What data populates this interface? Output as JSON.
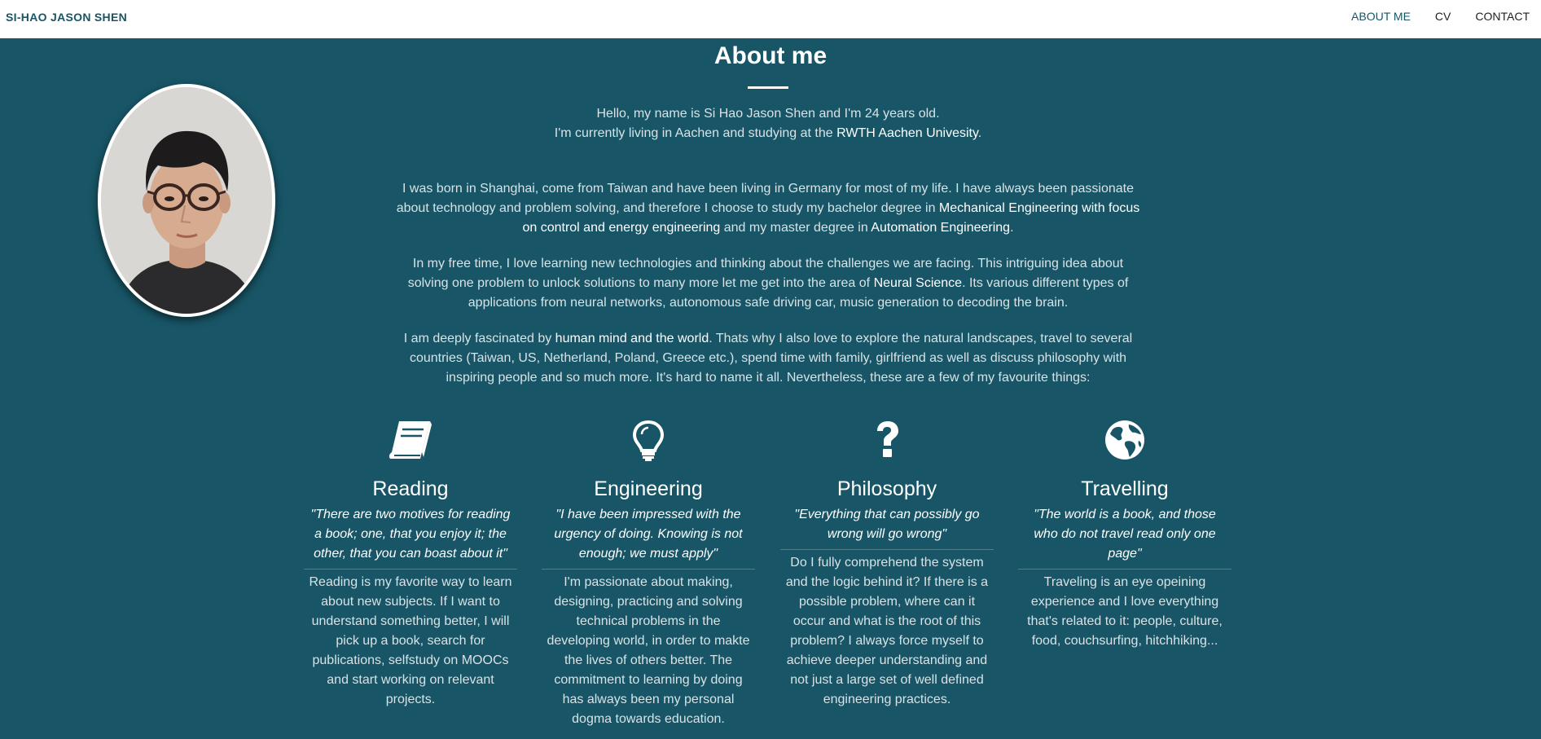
{
  "nav": {
    "brand": "SI-HAO JASON SHEN",
    "links": [
      "ABOUT ME",
      "CV",
      "CONTACT"
    ]
  },
  "about": {
    "title": "About me",
    "p1": [
      {
        "t": "Hello, my name is Si Hao Jason Shen and I'm 24 years old."
      },
      {
        "br": true
      },
      {
        "t": "I'm currently living in Aachen and studying at the "
      },
      {
        "t": "RWTH Aachen Univesity",
        "s": true
      },
      {
        "t": "."
      }
    ],
    "p2": [
      {
        "t": "I was born in Shanghai, come from Taiwan and have been living in Germany for most of my life. I have always been passionate about technology and problem solving, and therefore I choose to study my bachelor degree in "
      },
      {
        "t": "Mechanical Engineering with focus on control and energy engineering",
        "s": true
      },
      {
        "t": " and my master degree in "
      },
      {
        "t": "Automation Engineering",
        "s": true
      },
      {
        "t": "."
      }
    ],
    "p3": [
      {
        "t": "In my free time, I love learning new technologies and thinking about the challenges we are facing. This intriguing idea about solving one problem to unlock solutions to many more let me get into the area of "
      },
      {
        "t": "Neural Science",
        "s": true
      },
      {
        "t": ". Its various different types of applications from neural networks, autonomous safe driving car, music generation to decoding the brain."
      }
    ],
    "p4": [
      {
        "t": "I am deeply fascinated by "
      },
      {
        "t": "human mind and the world",
        "s": true
      },
      {
        "t": ". Thats why I also love to explore the natural landscapes, travel to several countries (Taiwan, US, Netherland, Poland, Greece etc.), spend time with family, girlfriend as well as discuss philosophy with inspiring people and so much more. It's hard to name it all. Nevertheless, these are a few of my favourite things:"
      }
    ]
  },
  "interests": [
    {
      "icon": "book-icon",
      "title": "Reading",
      "quote": "\"There are two motives for reading a book; one, that you enjoy it; the other, that you can boast about it\"",
      "desc": "Reading is my favorite way to learn about new subjects. If I want to understand something better, I will pick up a book, search for publications, selfstudy on MOOCs and start working on relevant projects."
    },
    {
      "icon": "lightbulb-icon",
      "title": "Engineering",
      "quote": "\"I have been impressed with the urgency of doing. Knowing is not enough; we must apply\"",
      "desc": "I'm passionate about making, designing, practicing and solving technical problems in the developing world, in order to makte the lives of others better. The commitment to learning by doing has always been my personal dogma towards education."
    },
    {
      "icon": "question-icon",
      "title": "Philosophy",
      "quote": "\"Everything that can possibly go wrong will go wrong\"",
      "desc": "Do I fully comprehend the system and the logic behind it? If there is a possible problem, where can it occur and what is the root of this problem? I always force myself to achieve deeper understanding and not just a large set of well defined engineering practices."
    },
    {
      "icon": "globe-icon",
      "title": "Travelling",
      "quote": "\"The world is a book, and those who do not travel read only one page\"",
      "desc": "Traveling is an eye opeining experience and I love everything that's related to it: people, culture, food, couchsurfing, hitchhiking..."
    }
  ]
}
